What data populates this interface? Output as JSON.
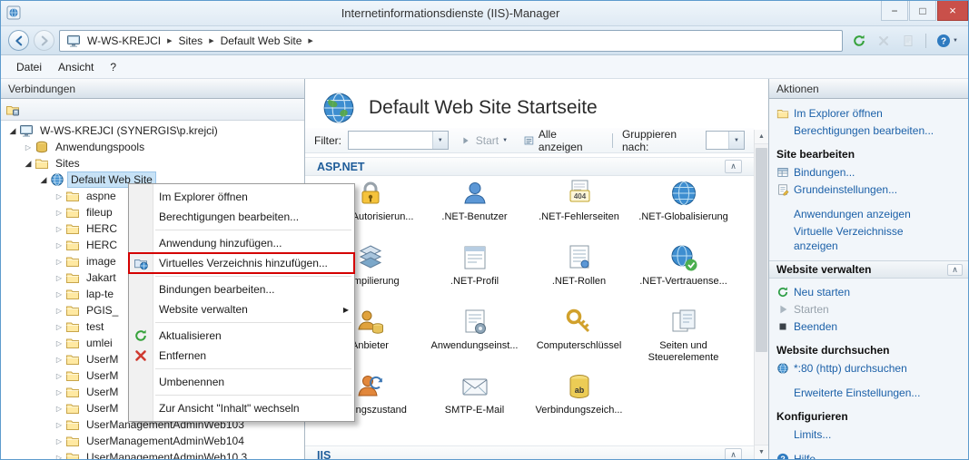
{
  "colors": {
    "accent_blue": "#1b60a8",
    "annotation_red": "#d40000",
    "close_button_red": "#c9504a",
    "selection_blue": "#c7e2f6"
  },
  "titlebar": {
    "title": "Internetinformationsdienste (IIS)-Manager"
  },
  "navbar": {
    "breadcrumb": [
      "W-WS-KREJCI",
      "Sites",
      "Default Web Site"
    ]
  },
  "menubar": {
    "items": [
      "Datei",
      "Ansicht",
      "?"
    ]
  },
  "connections": {
    "header": "Verbindungen",
    "tree": [
      {
        "label": "W-WS-KREJCI (SYNERGIS\\p.krejci)",
        "icon": "computer-icon",
        "indent": 0,
        "arrow": "open",
        "selected": false
      },
      {
        "label": "Anwendungspools",
        "icon": "apppool-icon",
        "indent": 1,
        "arrow": "closed",
        "selected": false
      },
      {
        "label": "Sites",
        "icon": "sites-folder-icon",
        "indent": 1,
        "arrow": "open",
        "selected": false
      },
      {
        "label": "Default Web Site",
        "icon": "site-icon",
        "indent": 2,
        "arrow": "open",
        "selected": true
      },
      {
        "label": "aspne",
        "icon": "folder-icon",
        "indent": 3,
        "arrow": "closed",
        "selected": false
      },
      {
        "label": "fileup",
        "icon": "folder-icon",
        "indent": 3,
        "arrow": "closed",
        "selected": false
      },
      {
        "label": "HERC",
        "icon": "folder-icon",
        "indent": 3,
        "arrow": "closed",
        "selected": false
      },
      {
        "label": "HERC",
        "icon": "folder-icon",
        "indent": 3,
        "arrow": "closed",
        "selected": false
      },
      {
        "label": "image",
        "icon": "folder-icon",
        "indent": 3,
        "arrow": "closed",
        "selected": false
      },
      {
        "label": "Jakart",
        "icon": "folder-icon",
        "indent": 3,
        "arrow": "closed",
        "selected": false
      },
      {
        "label": "lap-te",
        "icon": "folder-icon",
        "indent": 3,
        "arrow": "closed",
        "selected": false
      },
      {
        "label": "PGIS_",
        "icon": "folder-icon",
        "indent": 3,
        "arrow": "closed",
        "selected": false
      },
      {
        "label": "test",
        "icon": "folder-icon",
        "indent": 3,
        "arrow": "closed",
        "selected": false
      },
      {
        "label": "umlei",
        "icon": "folder-icon",
        "indent": 3,
        "arrow": "closed",
        "selected": false
      },
      {
        "label": "UserM",
        "icon": "folder-icon",
        "indent": 3,
        "arrow": "closed",
        "selected": false
      },
      {
        "label": "UserM",
        "icon": "folder-icon",
        "indent": 3,
        "arrow": "closed",
        "selected": false
      },
      {
        "label": "UserM",
        "icon": "folder-icon",
        "indent": 3,
        "arrow": "closed",
        "selected": false
      },
      {
        "label": "UserM",
        "icon": "folder-icon",
        "indent": 3,
        "arrow": "closed",
        "selected": false
      },
      {
        "label": "UserManagementAdminWeb103",
        "icon": "folder-icon",
        "indent": 3,
        "arrow": "closed",
        "selected": false
      },
      {
        "label": "UserManagementAdminWeb104",
        "icon": "folder-icon",
        "indent": 3,
        "arrow": "closed",
        "selected": false
      },
      {
        "label": "UserManagementAdminWeb10.3",
        "icon": "folder-icon",
        "indent": 3,
        "arrow": "closed",
        "selected": false
      }
    ]
  },
  "context_menu": {
    "items": [
      {
        "label": "Im Explorer öffnen"
      },
      {
        "label": "Berechtigungen bearbeiten..."
      },
      {
        "separator": true
      },
      {
        "label": "Anwendung hinzufügen..."
      },
      {
        "label": "Virtuelles Verzeichnis hinzufügen...",
        "icon": "virtual-directory-icon",
        "highlighted": true
      },
      {
        "separator": true
      },
      {
        "label": "Bindungen bearbeiten..."
      },
      {
        "label": "Website verwalten",
        "submenu": true
      },
      {
        "separator": true
      },
      {
        "label": "Aktualisieren",
        "icon": "refresh-icon"
      },
      {
        "label": "Entfernen",
        "icon": "delete-icon"
      },
      {
        "separator": true
      },
      {
        "label": "Umbenennen"
      },
      {
        "separator": true
      },
      {
        "label": "Zur Ansicht \"Inhalt\" wechseln"
      }
    ]
  },
  "main": {
    "title": "Default Web Site Startseite",
    "filter": {
      "label": "Filter:",
      "start": "Start",
      "show_all": "Alle anzeigen",
      "group_by": "Gruppieren nach:"
    },
    "sections": [
      {
        "name": "ASP.NET",
        "features": [
          {
            "label": ".NET-Autorisierun...",
            "icon": "lock-icon"
          },
          {
            "label": ".NET-Benutzer",
            "icon": "user-icon"
          },
          {
            "label": ".NET-Fehlerseiten",
            "icon": "error-page-icon"
          },
          {
            "label": ".NET-Globalisierung",
            "icon": "globe-icon"
          },
          {
            "label": "Kompilierung",
            "icon": "stack-icon"
          },
          {
            "label": ".NET-Profil",
            "icon": "profile-icon"
          },
          {
            "label": ".NET-Rollen",
            "icon": "roles-icon"
          },
          {
            "label": ".NET-Vertrauense...",
            "icon": "globe-check-icon"
          },
          {
            "label": "Anbieter",
            "icon": "provider-icon"
          },
          {
            "label": "Anwendungseinst...",
            "icon": "app-settings-icon"
          },
          {
            "label": "Computerschlüssel",
            "icon": "key-icon"
          },
          {
            "label": "Seiten und Steuerelemente",
            "icon": "pages-icon"
          },
          {
            "label": "Sitzungszustand",
            "icon": "session-icon"
          },
          {
            "label": "SMTP-E-Mail",
            "icon": "mail-icon"
          },
          {
            "label": "Verbindungszeich...",
            "icon": "database-icon"
          }
        ]
      },
      {
        "name": "IIS",
        "features": []
      }
    ]
  },
  "actions": {
    "header": "Aktionen",
    "groups": [
      {
        "items": [
          {
            "label": "Im Explorer öffnen",
            "icon": "explorer-icon"
          },
          {
            "label": "Berechtigungen bearbeiten..."
          }
        ]
      },
      {
        "heading": "Site bearbeiten",
        "items": [
          {
            "label": "Bindungen...",
            "icon": "bindings-icon"
          },
          {
            "label": "Grundeinstellungen...",
            "icon": "basic-settings-icon"
          },
          {
            "label": "Anwendungen anzeigen",
            "gap": true
          },
          {
            "label": "Virtuelle Verzeichnisse anzeigen"
          }
        ]
      },
      {
        "bar": "Website verwalten",
        "items": [
          {
            "label": "Neu starten",
            "icon": "restart-icon"
          },
          {
            "label": "Starten",
            "icon": "start-icon",
            "disabled": true
          },
          {
            "label": "Beenden",
            "icon": "stop-icon"
          }
        ]
      },
      {
        "heading": "Website durchsuchen",
        "items": [
          {
            "label": "*:80 (http) durchsuchen",
            "icon": "browse-icon"
          },
          {
            "label": "Erweiterte Einstellungen...",
            "gap": true
          }
        ]
      },
      {
        "heading": "Konfigurieren",
        "items": [
          {
            "label": "Limits..."
          }
        ]
      },
      {
        "items": [
          {
            "label": "Hilfe",
            "icon": "help-icon",
            "gap": true
          }
        ]
      }
    ]
  }
}
